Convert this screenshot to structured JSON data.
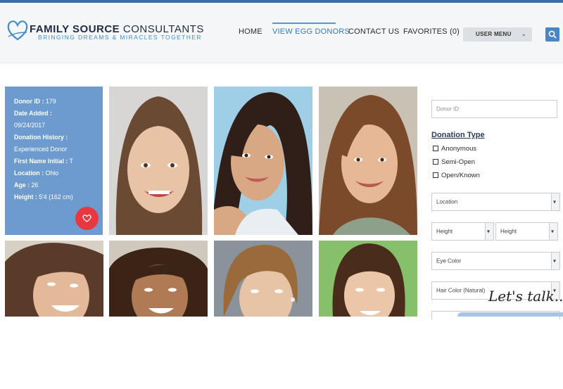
{
  "header": {
    "brand_bold": "FAMILY SOURCE",
    "brand_rest": " CONSULTANTS",
    "tagline": "BRINGING DREAMS & MIRACLES TOGETHER",
    "nav": [
      "HOME",
      "VIEW EGG DONORS",
      "CONTACT US",
      "FAVORITES (0)"
    ],
    "active_nav": "VIEW EGG DONORS",
    "user_menu": "USER MENU"
  },
  "donor_card": {
    "lines": [
      {
        "k": "Donor ID :",
        "v": " 179"
      },
      {
        "k": "Date Added :",
        "v": ""
      },
      {
        "k": "",
        "v": "09/24/2017"
      },
      {
        "k": "Donation History :",
        "v": ""
      },
      {
        "k": "",
        "v": "Experienced Donor"
      },
      {
        "k": "First Name Initial :",
        "v": " T"
      },
      {
        "k": "Location :",
        "v": " Ohio"
      },
      {
        "k": "Age :",
        "v": " 26"
      },
      {
        "k": "Height :",
        "v": " 5'4 (162 cm)"
      }
    ]
  },
  "filters": {
    "donor_id_placeholder": "Donor ID",
    "donation_type_title": "Donation Type",
    "donation_types": [
      "Anonymous",
      "Semi-Open",
      "Open/Known"
    ],
    "location": "Location",
    "height_from": "Height",
    "height_to": "Height",
    "eye_color": "Eye Color",
    "hair_color": "Hair Color (Natural)"
  },
  "chat": {
    "label": "Let's talk..."
  },
  "colors": {
    "accent": "#3a6ea5",
    "card_bg": "#6e9bcf",
    "heart": "#e8373f",
    "nav_active": "#3a78c0"
  }
}
